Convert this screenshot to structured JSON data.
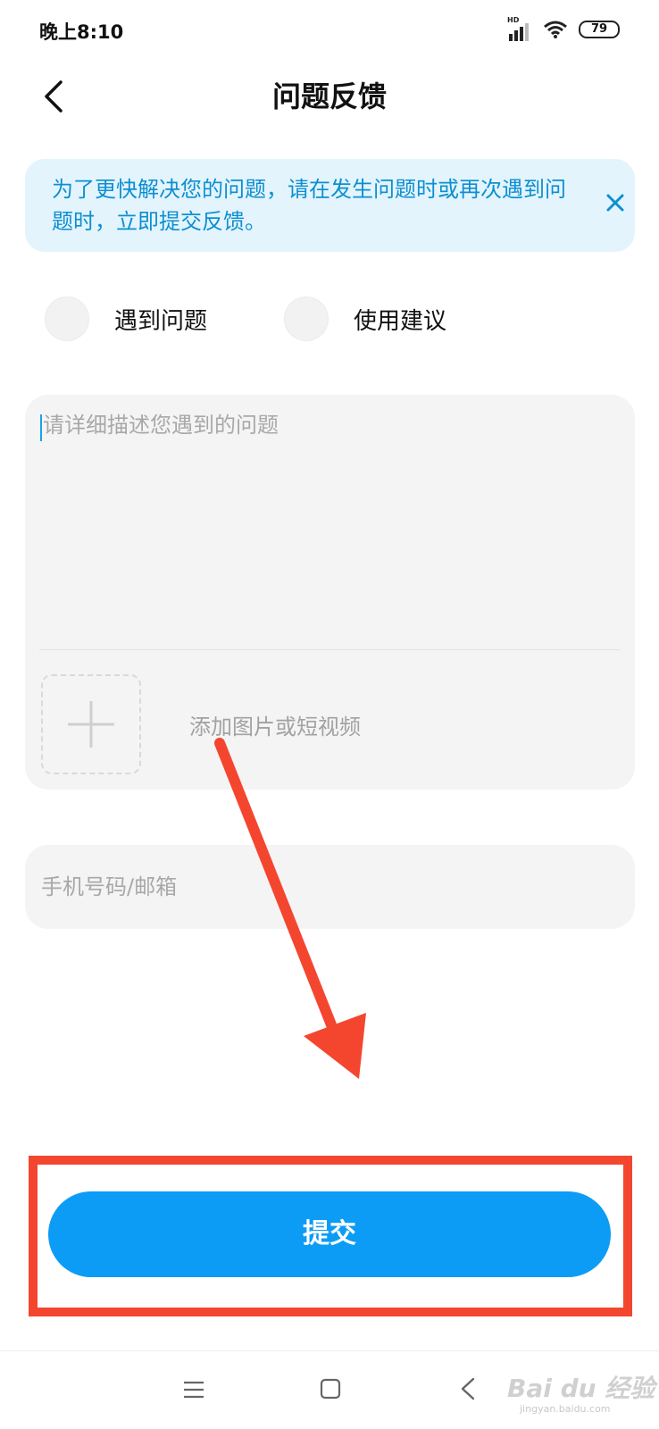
{
  "status_bar": {
    "time": "晚上8:10",
    "network_label": "HD",
    "battery": "79"
  },
  "header": {
    "title": "问题反馈",
    "back_icon": "chevron-left-icon"
  },
  "notice": {
    "text": "为了更快解决您的问题，请在发生问题时或再次遇到问题时，立即提交反馈。",
    "close_icon": "close-icon",
    "text_color": "#0d8fd1",
    "background": "#e3f4fd"
  },
  "feedback_types": [
    {
      "label": "遇到问题",
      "selected": false
    },
    {
      "label": "使用建议",
      "selected": false
    }
  ],
  "description": {
    "placeholder": "请详细描述您遇到的问题",
    "value": ""
  },
  "attachment": {
    "label": "添加图片或短视频",
    "icon": "plus-icon"
  },
  "contact": {
    "placeholder": "手机号码/邮箱",
    "value": ""
  },
  "submit": {
    "label": "提交",
    "color": "#0c9cf6"
  },
  "annotation": {
    "color": "#f4462f"
  },
  "nav_bar": {
    "menu_icon": "menu-icon",
    "home_icon": "square-home-icon",
    "back_icon": "back-triangle-icon"
  },
  "watermark": {
    "main": "Bai du 经验",
    "sub": "jingyan.baidu.com"
  }
}
